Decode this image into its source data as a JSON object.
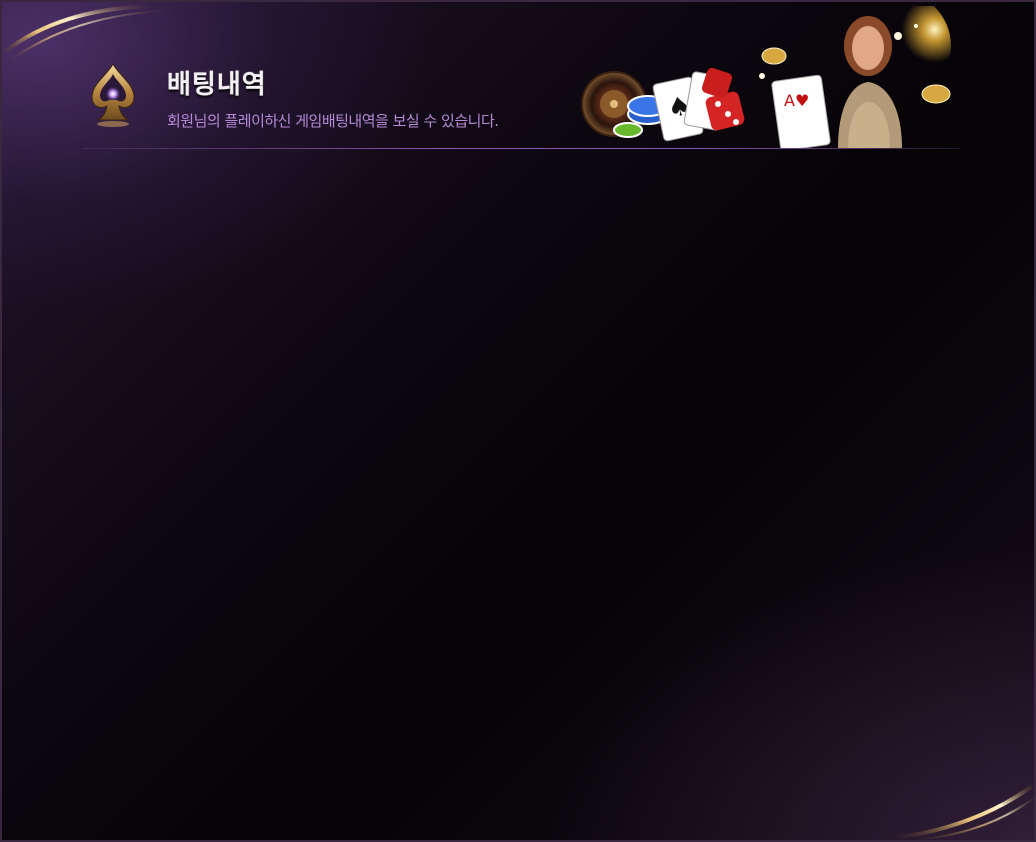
{
  "modal": {
    "title": "배팅내역",
    "subtitle": "회원님의 플레이하신 게임배팅내역을 보실 수 있습니다."
  },
  "icons": {
    "emblem": "spade-icon",
    "banner": "casino-banner-image"
  },
  "colors": {
    "background": "#0d0710",
    "accent": "#8a55b0",
    "subtitle": "#b68ad6",
    "gold": "#c89a58"
  }
}
